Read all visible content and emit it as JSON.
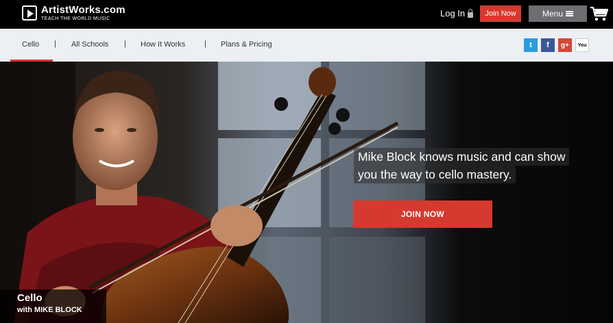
{
  "brand": {
    "name": "ArtistWorks.com",
    "tagline": "TEACH THE WORLD MUSIC"
  },
  "header": {
    "login_label": "Log In",
    "join_label": "Join Now",
    "menu_label": "Menu"
  },
  "subnav": {
    "items": [
      "Cello",
      "All Schools",
      "How It Works",
      "Plans & Pricing"
    ],
    "separator": "|",
    "active": "Cello"
  },
  "social": {
    "twitter": "t",
    "facebook": "f",
    "google": "g+",
    "youtube": "You"
  },
  "hero": {
    "tagline_line1": "Mike Block knows music and can show",
    "tagline_line2": "you the way to cello mastery.",
    "cta_label": "JOIN NOW",
    "caption_title": "Cello",
    "caption_subtitle": "with MIKE BLOCK"
  },
  "colors": {
    "accent_red": "#d6392f",
    "menu_gray": "#6d6e71",
    "subnav_bg": "#eceff3",
    "twitter": "#2a9de1",
    "facebook": "#3b5998",
    "google": "#d34836",
    "youtube": "#ffffff"
  }
}
